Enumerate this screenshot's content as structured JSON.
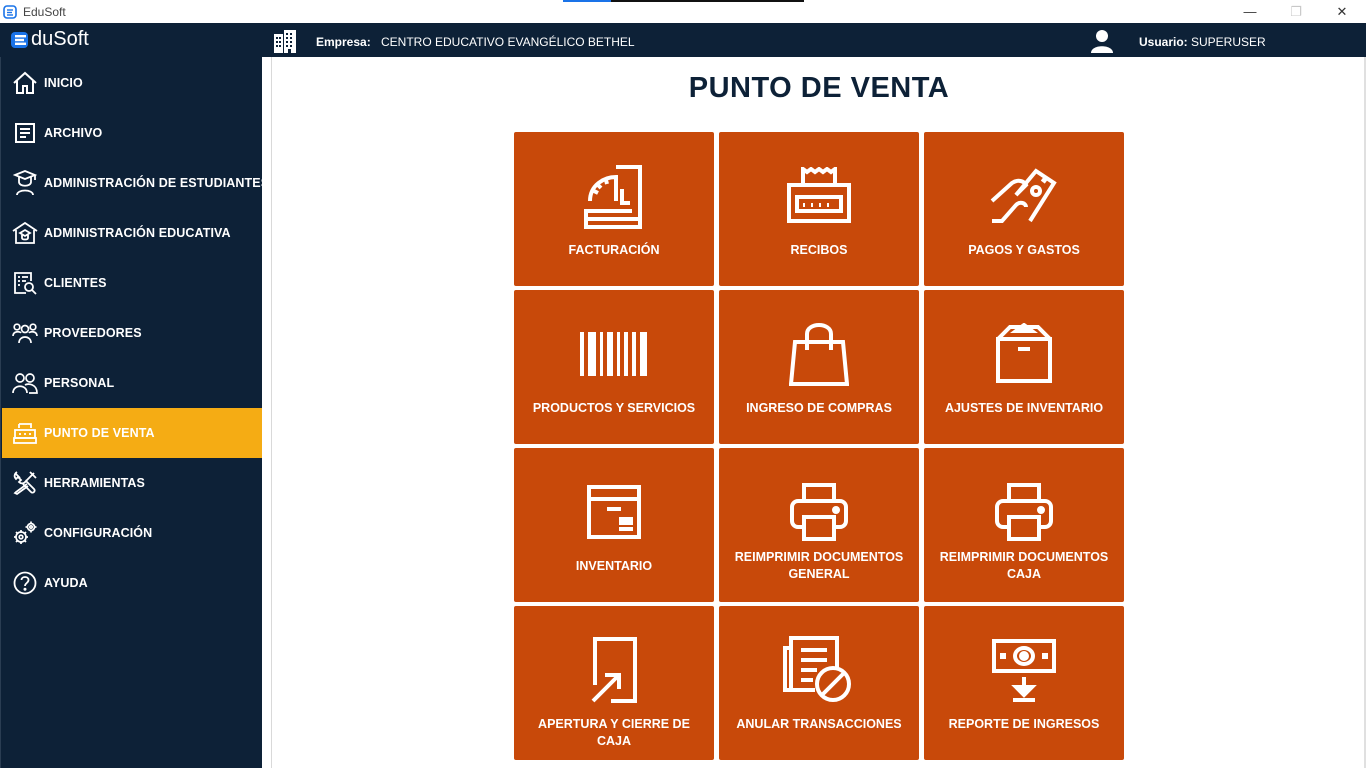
{
  "window": {
    "title": "EduSoft",
    "minimize_glyph": "—",
    "maximize_glyph": "❐",
    "close_glyph": "✕"
  },
  "header": {
    "logo_text": "duSoft",
    "company_label": "Empresa:",
    "company_value": "CENTRO EDUCATIVO EVANGÉLICO BETHEL",
    "user_label": "Usuario:",
    "user_value": "SUPERUSER"
  },
  "colors": {
    "navy": "#0d2137",
    "accent_yellow": "#f5ac14",
    "tile_orange": "#c8490a"
  },
  "sidebar": {
    "items": [
      {
        "label": "INICIO",
        "icon": "home-icon"
      },
      {
        "label": "ARCHIVO",
        "icon": "document-icon"
      },
      {
        "label": "ADMINISTRACIÓN DE ESTUDIANTES",
        "icon": "student-icon"
      },
      {
        "label": "ADMINISTRACIÓN EDUCATIVA",
        "icon": "school-icon"
      },
      {
        "label": "CLIENTES",
        "icon": "client-search-icon"
      },
      {
        "label": "PROVEEDORES",
        "icon": "group-icon"
      },
      {
        "label": "PERSONAL",
        "icon": "staff-icon"
      },
      {
        "label": "PUNTO DE VENTA",
        "icon": "cash-register-icon",
        "active": true
      },
      {
        "label": "HERRAMIENTAS",
        "icon": "tools-icon"
      },
      {
        "label": "CONFIGURACIÓN",
        "icon": "gears-icon"
      },
      {
        "label": "AYUDA",
        "icon": "help-icon"
      }
    ]
  },
  "main": {
    "title": "PUNTO DE VENTA",
    "tiles": [
      {
        "label": "FACTURACIÓN",
        "icon": "cash-register-icon"
      },
      {
        "label": "RECIBOS",
        "icon": "receipt-printer-icon"
      },
      {
        "label": "PAGOS Y GASTOS",
        "icon": "payment-hand-icon"
      },
      {
        "label": "PRODUCTOS Y SERVICIOS",
        "icon": "barcode-icon"
      },
      {
        "label": "INGRESO DE COMPRAS",
        "icon": "shopping-bag-icon"
      },
      {
        "label": "AJUSTES DE INVENTARIO",
        "icon": "open-box-icon"
      },
      {
        "label": "INVENTARIO",
        "icon": "box-icon"
      },
      {
        "label": "REIMPRIMIR DOCUMENTOS GENERAL",
        "icon": "printer-icon"
      },
      {
        "label": "REIMPRIMIR DOCUMENTOS CAJA",
        "icon": "printer-icon"
      },
      {
        "label": "APERTURA Y CIERRE DE CAJA",
        "icon": "cash-open-close-icon"
      },
      {
        "label": "ANULAR TRANSACCIONES",
        "icon": "cancel-document-icon"
      },
      {
        "label": "REPORTE DE INGRESOS",
        "icon": "money-report-icon"
      }
    ]
  }
}
